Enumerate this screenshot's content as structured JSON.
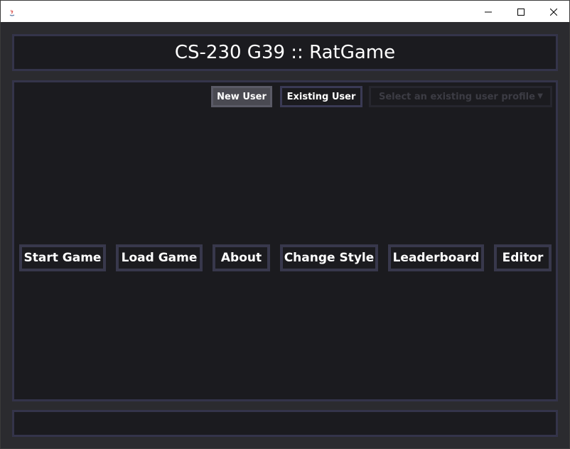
{
  "window": {
    "icon": "java-icon",
    "controls": {
      "minimize_icon": "minimize-icon",
      "maximize_icon": "maximize-icon",
      "close_icon": "close-icon"
    }
  },
  "header": {
    "title": "CS-230 G39 :: RatGame"
  },
  "user_bar": {
    "new_user_label": "New User",
    "existing_user_label": "Existing User",
    "profile_select_placeholder": "Select an existing user profile",
    "profile_select_arrow": "▼"
  },
  "menu": {
    "buttons": [
      {
        "label": "Start Game"
      },
      {
        "label": "Load Game"
      },
      {
        "label": "About"
      },
      {
        "label": "Change Style"
      },
      {
        "label": "Leaderboard"
      },
      {
        "label": "Editor"
      }
    ]
  },
  "colors": {
    "background": "#2b2b2f",
    "panel": "#1b1b1f",
    "panel_border": "#34344a",
    "text": "#ffffff"
  }
}
